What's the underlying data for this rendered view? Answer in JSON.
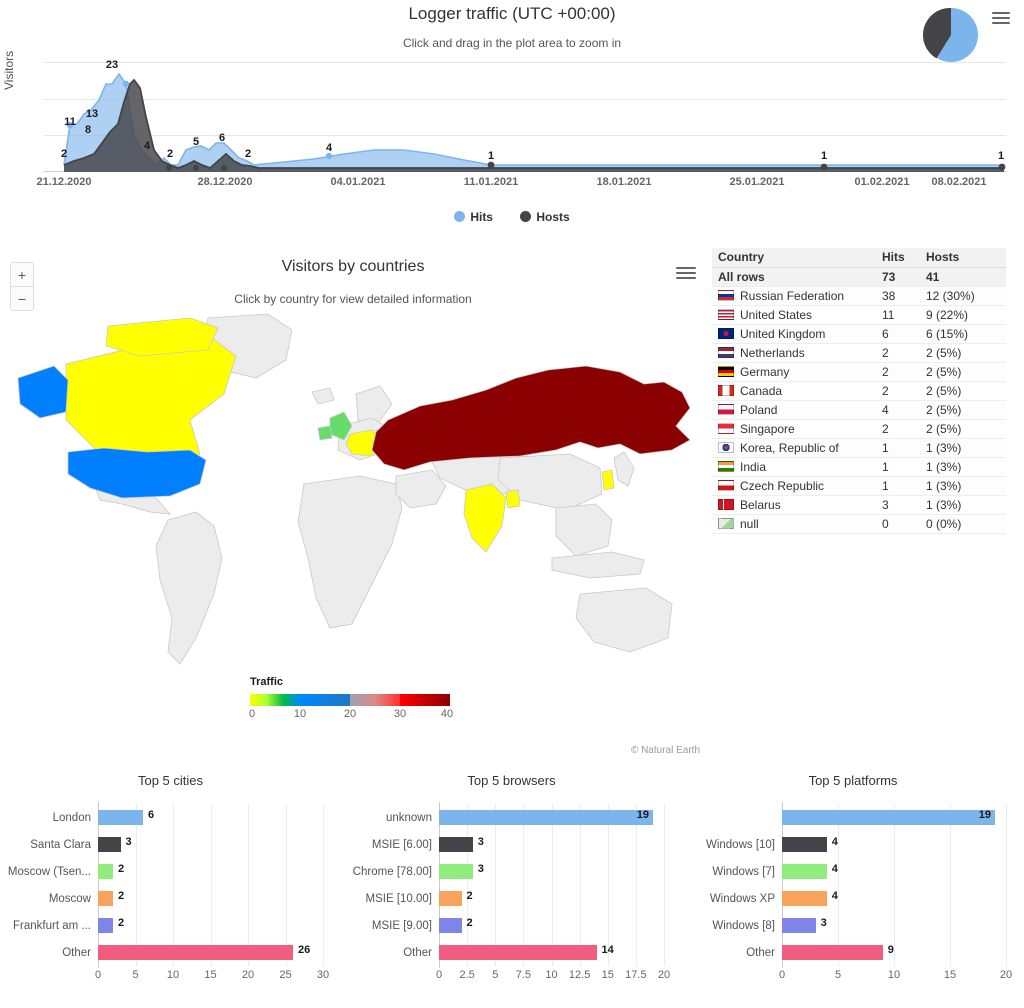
{
  "traffic": {
    "title": "Logger traffic (UTC +00:00)",
    "subtitle": "Click and drag in the plot area to zoom in",
    "ylabel": "Visitors",
    "menu_icon": "hamburger-menu-icon",
    "pie_icon": "pie-chart-icon",
    "legend": [
      {
        "label": "Hits",
        "color": "#7cb5ec"
      },
      {
        "label": "Hosts",
        "color": "#434348"
      }
    ]
  },
  "map": {
    "title": "Visitors by countries",
    "subtitle": "Click by country for view detailed information",
    "zoom_in": "+",
    "zoom_out": "−",
    "credit": "© Natural Earth",
    "scale": {
      "caption": "Traffic",
      "ticks": [
        "0",
        "10",
        "20",
        "30",
        "40"
      ],
      "colors": [
        "#ffff00",
        "#00b050",
        "#0080ff",
        "#0070c0",
        "#ff3030",
        "#8b0000"
      ]
    },
    "country_fills": {
      "RUS": "#8b0000",
      "USA": "#0080ff",
      "CAN": "#ffff00",
      "GBR": "#66dd66",
      "POL": "#44dd44",
      "DEU": "#ffff00",
      "BLR": "#88ee66",
      "IND": "#ffff00",
      "KOR": "#ffff00",
      "CZE": "#ffff00",
      "NLD": "#ffff00",
      "default": "#ececec"
    }
  },
  "country_table": {
    "columns": [
      "Country",
      "Hits",
      "Hosts"
    ],
    "all_rows": {
      "label": "All rows",
      "hits": "73",
      "hosts": "41"
    },
    "rows": [
      {
        "flag": "flag-ru",
        "country": "Russian Federation",
        "hits": "38",
        "hosts": "12 (30%)"
      },
      {
        "flag": "flag-us",
        "country": "United States",
        "hits": "11",
        "hosts": "9 (22%)"
      },
      {
        "flag": "flag-gb",
        "country": "United Kingdom",
        "hits": "6",
        "hosts": "6 (15%)"
      },
      {
        "flag": "flag-nl",
        "country": "Netherlands",
        "hits": "2",
        "hosts": "2 (5%)"
      },
      {
        "flag": "flag-de",
        "country": "Germany",
        "hits": "2",
        "hosts": "2 (5%)"
      },
      {
        "flag": "flag-ca",
        "country": "Canada",
        "hits": "2",
        "hosts": "2 (5%)"
      },
      {
        "flag": "flag-pl",
        "country": "Poland",
        "hits": "4",
        "hosts": "2 (5%)"
      },
      {
        "flag": "flag-sg",
        "country": "Singapore",
        "hits": "2",
        "hosts": "2 (5%)"
      },
      {
        "flag": "flag-kr",
        "country": "Korea, Republic of",
        "hits": "1",
        "hosts": "1 (3%)"
      },
      {
        "flag": "flag-in",
        "country": "India",
        "hits": "1",
        "hosts": "1 (3%)"
      },
      {
        "flag": "flag-cz",
        "country": "Czech Republic",
        "hits": "1",
        "hosts": "1 (3%)"
      },
      {
        "flag": "flag-by",
        "country": "Belarus",
        "hits": "3",
        "hosts": "1 (3%)"
      },
      {
        "flag": "flag-null",
        "country": "null",
        "hits": "0",
        "hosts": "0 (0%)"
      }
    ]
  },
  "chart_data": [
    {
      "type": "area",
      "name": "logger-traffic",
      "title": "Logger traffic (UTC +00:00)",
      "subtitle": "Click and drag in the plot area to zoom in",
      "xlabel": "",
      "ylabel": "Visitors",
      "ylim": [
        0,
        30
      ],
      "yticks": [
        0,
        10,
        20,
        30
      ],
      "grid": true,
      "legend_position": "bottom",
      "xticks": [
        "21.12.2020",
        "28.12.2020",
        "04.01.2021",
        "11.01.2021",
        "18.01.2021",
        "25.01.2021",
        "01.02.2021",
        "08.02.2021"
      ],
      "x": [
        "21.12.2020",
        "22.12.2020",
        "23.12.2020",
        "24.12.2020",
        "25.12.2020",
        "26.12.2020",
        "27.12.2020",
        "28.12.2020",
        "29.12.2020",
        "04.01.2021",
        "11.01.2021",
        "01.02.2021",
        "12.02.2021"
      ],
      "series": [
        {
          "name": "Hits",
          "color": "#7cb5ec",
          "values": [
            2,
            11,
            13,
            23,
            4,
            2,
            5,
            6,
            2,
            4,
            1,
            1,
            1
          ]
        },
        {
          "name": "Hosts",
          "color": "#434348",
          "values": [
            2,
            3,
            8,
            21,
            2,
            1,
            2,
            3,
            1,
            1,
            1,
            1,
            1
          ]
        }
      ],
      "point_labels": [
        {
          "x": "21.12.2020",
          "value": 2
        },
        {
          "x": "22.12.2020",
          "value": 11
        },
        {
          "x": "23.12.2020",
          "value": 13
        },
        {
          "x": "23.12.2020b",
          "value": 8
        },
        {
          "x": "24.12.2020",
          "value": 23
        },
        {
          "x": "25.12.2020",
          "value": 4
        },
        {
          "x": "26.12.2020",
          "value": 2
        },
        {
          "x": "27.12.2020",
          "value": 5
        },
        {
          "x": "28.12.2020",
          "value": 6
        },
        {
          "x": "29.12.2020",
          "value": 2
        },
        {
          "x": "04.01.2021",
          "value": 4
        },
        {
          "x": "11.01.2021",
          "value": 1
        },
        {
          "x": "01.02.2021",
          "value": 1
        },
        {
          "x": "12.02.2021",
          "value": 1
        }
      ]
    },
    {
      "type": "pie",
      "name": "traffic-summary-pie",
      "title": "",
      "labels": [
        "Hits",
        "Hosts"
      ],
      "values": [
        64,
        36
      ],
      "colors": [
        "#7cb5ec",
        "#434348"
      ]
    },
    {
      "type": "bar",
      "name": "top-5-cities",
      "title": "Top 5 cities",
      "orientation": "horizontal",
      "xlabel": "",
      "ylabel": "",
      "xlim": [
        0,
        30
      ],
      "xticks": [
        0,
        5,
        10,
        15,
        20,
        25,
        30
      ],
      "grid": true,
      "categories": [
        "London",
        "Santa Clara",
        "Moscow (Tsen...",
        "Moscow",
        "Frankfurt am ...",
        "Other"
      ],
      "values": [
        6,
        3,
        2,
        2,
        2,
        26
      ],
      "colors": [
        "#7cb5ec",
        "#434348",
        "#90ed7d",
        "#f7a35c",
        "#8085e9",
        "#f15c80"
      ]
    },
    {
      "type": "bar",
      "name": "top-5-browsers",
      "title": "Top 5 browsers",
      "orientation": "horizontal",
      "xlabel": "",
      "ylabel": "",
      "xlim": [
        0,
        20
      ],
      "xticks": [
        0,
        2.5,
        5,
        7.5,
        10,
        12.5,
        15,
        17.5,
        20
      ],
      "grid": true,
      "categories": [
        "unknown",
        "MSIE [6.00]",
        "Chrome [78.00]",
        "MSIE [10.00]",
        "MSIE [9.00]",
        "Other"
      ],
      "values": [
        19,
        3,
        3,
        2,
        2,
        14
      ],
      "colors": [
        "#7cb5ec",
        "#434348",
        "#90ed7d",
        "#f7a35c",
        "#8085e9",
        "#f15c80"
      ]
    },
    {
      "type": "bar",
      "name": "top-5-platforms",
      "title": "Top 5 platforms",
      "orientation": "horizontal",
      "xlabel": "",
      "ylabel": "",
      "xlim": [
        0,
        20
      ],
      "xticks": [
        0,
        5,
        10,
        15,
        20
      ],
      "grid": true,
      "categories": [
        "",
        "Windows [10]",
        "Windows [7]",
        "Windows XP",
        "Windows [8]",
        "Other"
      ],
      "values": [
        19,
        4,
        4,
        4,
        3,
        9
      ],
      "colors": [
        "#7cb5ec",
        "#434348",
        "#90ed7d",
        "#f7a35c",
        "#8085e9",
        "#f15c80"
      ]
    }
  ]
}
